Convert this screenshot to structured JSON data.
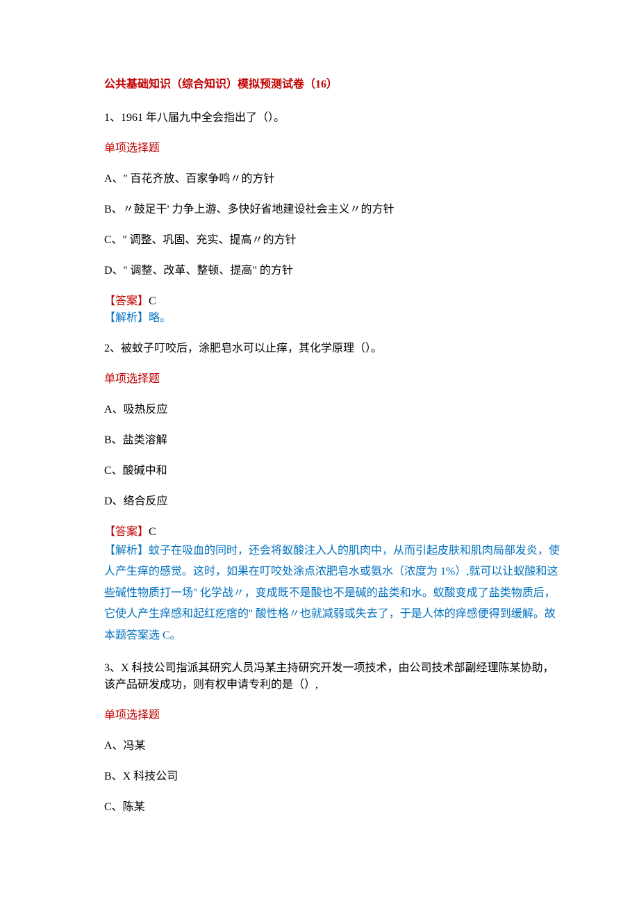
{
  "title": "公共基础知识（综合知识）模拟预测试卷（16）",
  "q1": {
    "text": "1、1961 年八届九中全会指出了（）。",
    "type": "单项选择题",
    "opts": {
      "a": "A、'' 百花齐放、百家争鸣〃的方针",
      "b": "B、〃鼓足干' 力争上游、多快好省地建设社会主义〃的方针",
      "c": "C、'' 调整、巩固、充实、提高〃的方针",
      "d": "D、'' 调整、改革、整顿、提高\" 的方针"
    },
    "answer_label": "【答案】",
    "answer_value": "C",
    "analysis_label": "【解析】",
    "analysis_text": "略。"
  },
  "q2": {
    "text": "2、被蚊子叮咬后，涂肥皂水可以止痒，其化学原理（）。",
    "type": "单项选择题",
    "opts": {
      "a": "A、吸热反应",
      "b": "B、盐类溶解",
      "c": "C、酸碱中和",
      "d": "D、络合反应"
    },
    "answer_label": "【答案】",
    "answer_value": "C",
    "analysis_label": "【解析】",
    "analysis_text": "蚊子在吸血的同时，还会将蚁酸注入人的肌肉中，从而引起皮肤和肌肉局部发炎，使人产生痒的感觉。这时，如果在叮咬处涂点浓肥皂水或氨水（浓度为 1%）,就可以让蚁酸和这些碱性物质打一场'' 化学战〃，变成既不是酸也不是碱的盐类和水。蚁酸变成了盐类物质后，它使人产生痒感和起红疙瘩的'' 酸性格〃也就减弱或失去了，于是人体的痒感便得到缓解。故本题答案选 C。"
  },
  "q3": {
    "text": "3、X 科技公司指派其研究人员冯某主持研究开发一项技术，由公司技术部副经理陈某协助，该产品研发成功，则有权申请专利的是（）,",
    "type": "单项选择题",
    "opts": {
      "a": "A、冯某",
      "b": "B、X 科技公司",
      "c": "C、陈某"
    }
  }
}
